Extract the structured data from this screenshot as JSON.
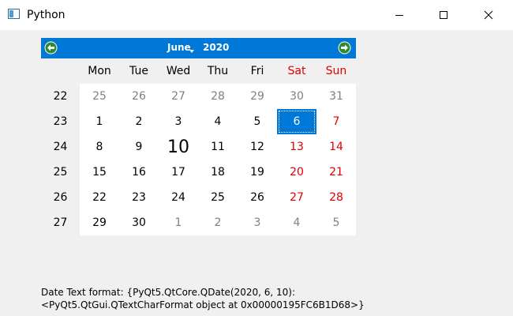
{
  "window": {
    "title": "Python"
  },
  "calendar": {
    "month": "June",
    "year": "2020",
    "weekdays": [
      "Mon",
      "Tue",
      "Wed",
      "Thu",
      "Fri",
      "Sat",
      "Sun"
    ],
    "weeks": [
      {
        "num": "22",
        "days": [
          "25",
          "26",
          "27",
          "28",
          "29",
          "30",
          "31"
        ]
      },
      {
        "num": "23",
        "days": [
          "1",
          "2",
          "3",
          "4",
          "5",
          "6",
          "7"
        ]
      },
      {
        "num": "24",
        "days": [
          "8",
          "9",
          "10",
          "11",
          "12",
          "13",
          "14"
        ]
      },
      {
        "num": "25",
        "days": [
          "15",
          "16",
          "17",
          "18",
          "19",
          "20",
          "21"
        ]
      },
      {
        "num": "26",
        "days": [
          "22",
          "23",
          "24",
          "25",
          "26",
          "27",
          "28"
        ]
      },
      {
        "num": "27",
        "days": [
          "29",
          "30",
          "1",
          "2",
          "3",
          "4",
          "5"
        ]
      }
    ],
    "selected_day": "6",
    "today_day": "10"
  },
  "status": {
    "line1": "Date Text format: {PyQt5.QtCore.QDate(2020, 6, 10):",
    "line2": "<PyQt5.QtGui.QTextCharFormat object at 0x00000195FC6B1D68>}"
  },
  "colors": {
    "accent": "#0078d7",
    "weekend": "#e00000",
    "other_month": "#808080"
  },
  "icons": {
    "prev": "green-left-arrow-icon",
    "next": "green-right-arrow-icon",
    "minimize": "minimize-icon",
    "maximize": "maximize-icon",
    "close": "close-icon"
  }
}
